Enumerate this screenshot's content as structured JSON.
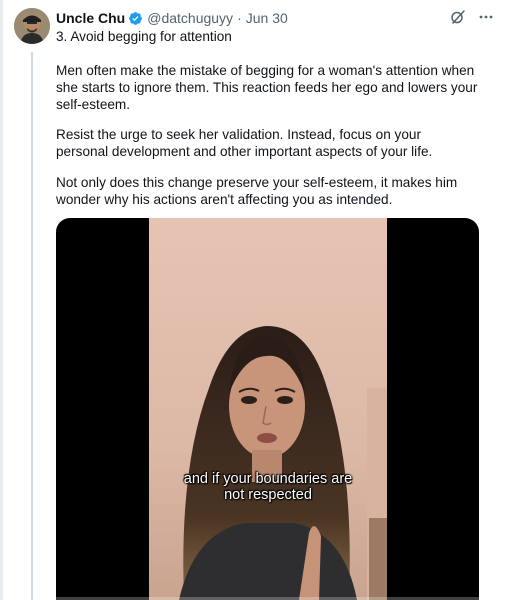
{
  "tweet": {
    "author": {
      "name": "Uncle Chu",
      "handle": "@datchuguyy",
      "verified": true,
      "avatar_icon": "avatar-man-cap"
    },
    "separator": "·",
    "date": "Jun 30",
    "actions": {
      "grok_icon": "grok-icon",
      "more_icon": "more-icon"
    },
    "title": "3. Avoid begging for attention",
    "paragraphs": [
      "Men often make the mistake of begging for a woman's attention when she starts to ignore them. This reaction feeds her ego and lowers your self-esteem.",
      "Resist the urge to seek her validation. Instead, focus on your personal development and other important aspects of your life.",
      "Not only does this change preserve your self-esteem, it makes him wonder why his actions aren't affecting you as intended."
    ],
    "media": {
      "type": "video",
      "caption_line1": "and if your boundaries are",
      "caption_line2": "not respected"
    }
  },
  "colors": {
    "verified_badge": "#1d9bf0",
    "secondary_text": "#536471",
    "thread_line": "#cfd9de"
  }
}
